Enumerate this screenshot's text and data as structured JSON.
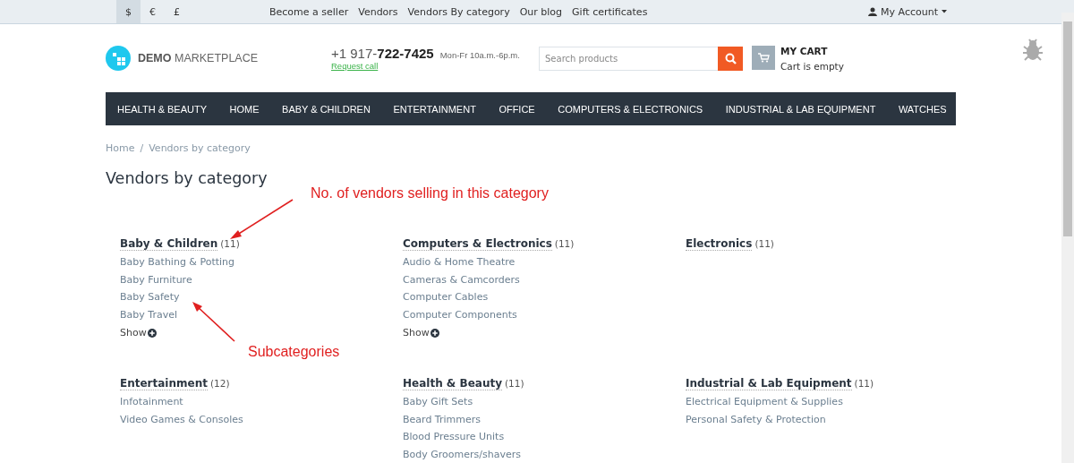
{
  "top_bar": {
    "currencies": [
      {
        "label": "$",
        "selected": true
      },
      {
        "label": "€",
        "selected": false
      },
      {
        "label": "£",
        "selected": false
      }
    ],
    "links": [
      "Become a seller",
      "Vendors",
      "Vendors By category",
      "Our blog",
      "Gift certificates"
    ],
    "account": "My Account"
  },
  "header": {
    "logo": {
      "bold": "DEMO",
      "light": "MARKETPLACE"
    },
    "phone": {
      "prefix": "+1 917-",
      "number": "722-7425",
      "hours": "Mon-Fr 10a.m.-6p.m.",
      "request": "Request call"
    },
    "search": {
      "placeholder": "Search products"
    },
    "cart": {
      "title": "MY CART",
      "status": "Cart is empty"
    }
  },
  "nav": [
    "HEALTH & BEAUTY",
    "HOME",
    "BABY & CHILDREN",
    "ENTERTAINMENT",
    "OFFICE",
    "COMPUTERS & ELECTRONICS",
    "INDUSTRIAL & LAB EQUIPMENT",
    "WATCHES"
  ],
  "breadcrumb": {
    "items": [
      "Home",
      "Vendors by category"
    ],
    "separator": "/"
  },
  "title": "Vendors by category",
  "categories": [
    {
      "name": "Baby & Children",
      "count": "(11)",
      "subcategories": [
        "Baby Bathing & Potting",
        "Baby Furniture",
        "Baby Safety",
        "Baby Travel"
      ],
      "show": "Show"
    },
    {
      "name": "Computers & Electronics",
      "count": "(11)",
      "subcategories": [
        "Audio & Home Theatre",
        "Cameras & Camcorders",
        "Computer Cables",
        "Computer Components"
      ],
      "show": "Show"
    },
    {
      "name": "Electronics",
      "count": "(11)"
    },
    {
      "name": "Entertainment",
      "count": "(12)",
      "subcategories": [
        "Infotainment",
        "Video Games & Consoles"
      ]
    },
    {
      "name": "Health & Beauty",
      "count": "(11)",
      "subcategories": [
        "Baby Gift Sets",
        "Beard Trimmers",
        "Blood Pressure Units",
        "Body Groomers/shavers"
      ]
    },
    {
      "name": "Industrial & Lab Equipment",
      "count": "(11)",
      "subcategories": [
        "Electrical Equipment & Supplies",
        "Personal Safety & Protection"
      ]
    }
  ],
  "annotations": [
    "No. of vendors selling in this category",
    "Subcategories"
  ]
}
